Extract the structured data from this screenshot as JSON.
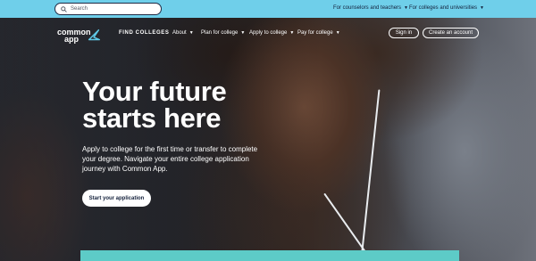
{
  "utility_bar": {
    "search_placeholder": "Search",
    "links": [
      {
        "label": "For counselors and teachers"
      },
      {
        "label": "For colleges and universities"
      }
    ]
  },
  "nav": {
    "logo_text_line1": "common",
    "logo_text_line2": "app",
    "find_colleges": "FIND COLLEGES",
    "about": "About",
    "plan": "Plan for college",
    "apply": "Apply to college",
    "pay": "Pay for college",
    "sign_in": "Sign in",
    "create_account": "Create an account"
  },
  "hero": {
    "headline_line1": "Your future",
    "headline_line2": "starts here",
    "subtext": "Apply to college for the first time or transfer to complete your degree. Navigate your entire college application journey with Common App.",
    "cta": "Start your application"
  },
  "icons": {
    "search": "search-icon",
    "caret": "chevron-down-icon",
    "logo_mark": "common-app-logo-icon"
  },
  "colors": {
    "utility_bar": "#6fcfea",
    "teal_band": "#5dcbc7",
    "navy_text": "#13203b",
    "logo_accent": "#5ec8e6"
  }
}
